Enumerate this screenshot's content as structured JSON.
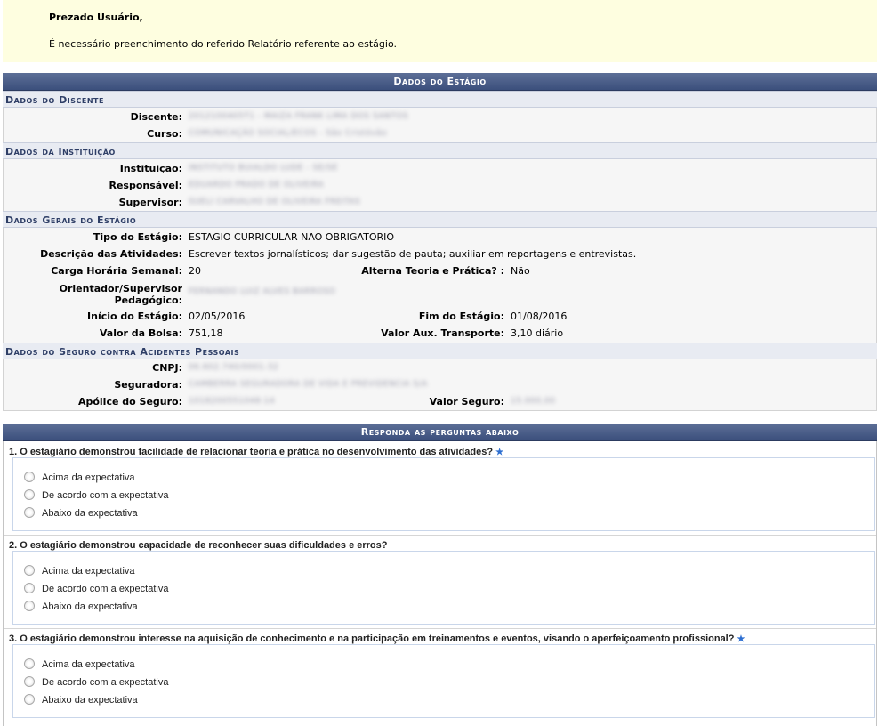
{
  "notice": {
    "greeting": "Prezado Usuário,",
    "message": "É necessário preenchimento do referido Relatório referente ao estágio."
  },
  "dados": {
    "title": "Dados do Estágio",
    "discente_section": "Dados do Discente",
    "discente_label": "Discente:",
    "discente_value": "2012100405T1 - MAIZA FRANK LIMA DOS SANTOS",
    "curso_label": "Curso:",
    "curso_value": "COMUNICAÇÃO SOCIAL/ECOS - São Cristóvão",
    "instituicao_section": "Dados da Instituição",
    "instituicao_label": "Instituição:",
    "instituicao_value": "INSTITUTO BUIALDO LUDE - SE/SE",
    "responsavel_label": "Responsável:",
    "responsavel_value": "EDUARDO PRADO DE OLIVEIRA",
    "supervisor_label": "Supervisor:",
    "supervisor_value": "SUELI CARVALHO DE OLIVEIRA FREITAS",
    "gerais_section": "Dados Gerais do Estágio",
    "tipo_label": "Tipo do Estágio:",
    "tipo_value": "ESTAGIO CURRICULAR NAO OBRIGATORIO",
    "descricao_label": "Descrição das Atividades:",
    "descricao_value": "Escrever textos jornalísticos; dar sugestão de pauta; auxiliar em reportagens e entrevistas.",
    "carga_label": "Carga Horária Semanal:",
    "carga_value": "20",
    "alterna_label": "Alterna Teoria e Prática? :",
    "alterna_value": "Não",
    "orientador_label_1": "Orientador/Supervisor",
    "orientador_label_2": "Pedagógico:",
    "orientador_value": "FERNANDO LUIZ ALVES BARROSO",
    "inicio_label": "Início do Estágio:",
    "inicio_value": "02/05/2016",
    "fim_label": "Fim do Estágio:",
    "fim_value": "01/08/2016",
    "bolsa_label": "Valor da Bolsa:",
    "bolsa_value": "751,18",
    "transporte_label": "Valor Aux. Transporte:",
    "transporte_value": "3,10 diário",
    "seguro_section": "Dados do Seguro contra Acidentes Pessoais",
    "cnpj_label": "CNPJ:",
    "cnpj_value": "06.602.740/0001-32",
    "seguradora_label": "Seguradora:",
    "seguradora_value": "CAMBERRA SEGURADORA DE VIDA E PREVIDENCIA S/A",
    "apolice_label": "Apólice do Seguro:",
    "apolice_value": "1018200551048-14",
    "valor_seguro_label": "Valor Seguro:",
    "valor_seguro_value": "15.000,00"
  },
  "perguntas": {
    "title": "Responda as perguntas abaixo",
    "questions": [
      {
        "text": "1. O estagiário demonstrou facilidade de relacionar teoria e prática no desenvolvimento das atividades?",
        "required": "★",
        "options": [
          "Acima da expectativa",
          "De acordo com a expectativa",
          "Abaixo da expectativa"
        ]
      },
      {
        "text": "2. O estagiário demonstrou capacidade de reconhecer suas dificuldades e erros?",
        "required": "",
        "options": [
          "Acima da expectativa",
          "De acordo com a expectativa",
          "Abaixo da expectativa"
        ]
      },
      {
        "text": "3. O estagiário demonstrou interesse na aquisição de conhecimento e na participação em treinamentos e eventos, visando o aperfeiçoamento profissional?",
        "required": "★",
        "options": [
          "Acima da expectativa",
          "De acordo com a expectativa",
          "Abaixo da expectativa"
        ]
      }
    ]
  }
}
